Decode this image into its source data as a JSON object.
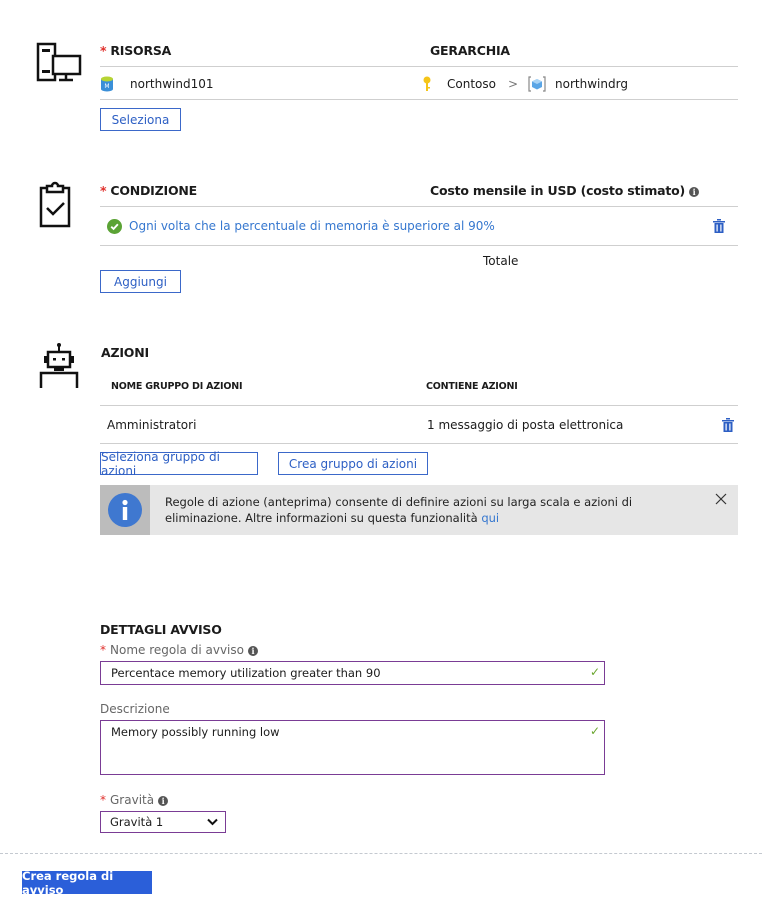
{
  "resource": {
    "heading": "RISORSA",
    "hierarchy_heading": "GERARCHIA",
    "name": "northwind101",
    "hierarchy": [
      "Contoso",
      "northwindrg"
    ],
    "hierarchy_separator": ">",
    "select_button": "Seleziona"
  },
  "condition": {
    "heading": "CONDIZIONE",
    "cost_heading": "Costo mensile in USD (costo stimato)",
    "condition_text": "Ogni volta che la percentuale di memoria è superiore al 90%",
    "total_label": "Totale",
    "add_button": "Aggiungi"
  },
  "actions": {
    "heading": "AZIONI",
    "columns": [
      "NOME GRUPPO DI AZIONI",
      "CONTIENE AZIONI"
    ],
    "rows": [
      {
        "name": "Amministratori",
        "contains": "1 messaggio di posta elettronica"
      }
    ],
    "select_group_button": "Seleziona gruppo di azioni",
    "create_group_button": "Crea gruppo di azioni",
    "banner": {
      "text": "Regole di azione (anteprima) consente di definire azioni su larga scala e azioni di eliminazione. Altre informazioni su questa funzionalità",
      "link": "qui"
    }
  },
  "details": {
    "heading": "DETTAGLI AVVISO",
    "rule_name_label": "Nome regola di avviso",
    "rule_name_value": "Percentace memory utilization greater than 90",
    "description_label": "Descrizione",
    "description_value": "Memory possibly running low",
    "severity_label": "Gravità",
    "severity_value": "Gravità 1"
  },
  "footer": {
    "create_button": "Crea regola di avviso"
  },
  "colors": {
    "accent": "#3b68c9",
    "primary_button": "#2b5fd9",
    "field_border": "#7a3c95",
    "valid_check": "#6aa62f",
    "required": "#e0302c"
  }
}
